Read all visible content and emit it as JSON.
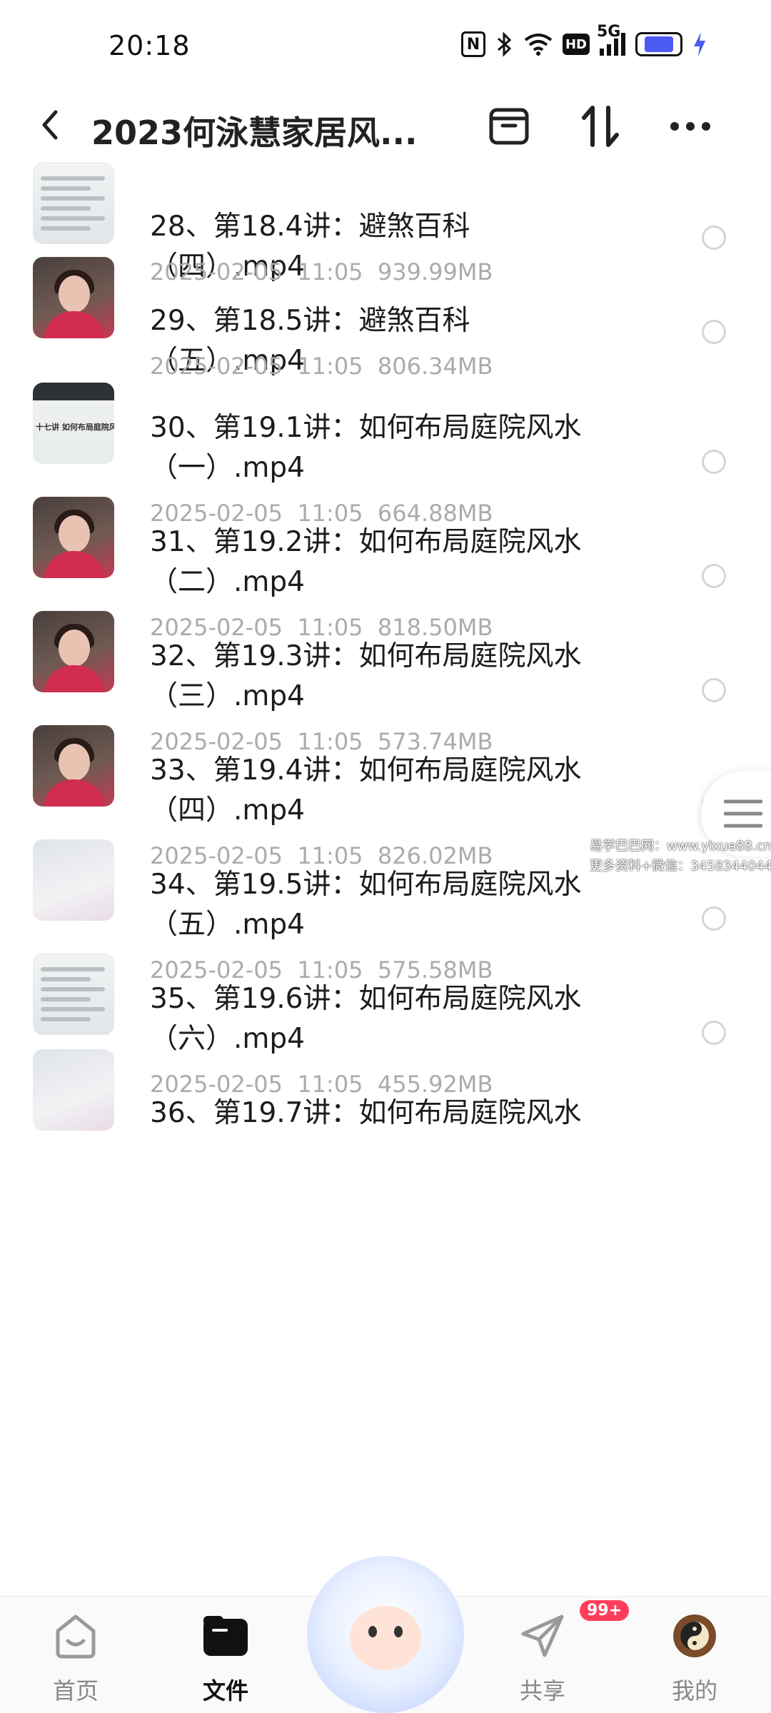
{
  "status_bar": {
    "time": "20:18",
    "icons": [
      "nfc-icon",
      "bluetooth-icon",
      "wifi-icon",
      "hd-icon",
      "signal-5g-icon",
      "battery-icon",
      "charging-bolt-icon"
    ],
    "nfc_label": "N",
    "hd_label": "HD",
    "signal_label": "5G",
    "battery_level": 0.75,
    "battery_color": "#4c5bf1"
  },
  "header": {
    "title": "2023何泳慧家居风...",
    "icons": [
      "back-icon",
      "box-icon",
      "sort-icon",
      "more-icon"
    ]
  },
  "files": [
    {
      "name": "28、第18.4讲：避煞百科（四）.mp4",
      "date": "2025-02-05  11:05",
      "size": "939.99MB",
      "thumb": "doc"
    },
    {
      "name": "29、第18.5讲：避煞百科（五）.mp4",
      "date": "2025-02-05  11:05",
      "size": "806.34MB",
      "thumb": "person"
    },
    {
      "name": "30、第19.1讲：如何布局庭院风水（一）.mp4",
      "date": "2025-02-05  11:05",
      "size": "664.88MB",
      "thumb": "garden",
      "thumb_caption": "十七讲 如何布局庭院风"
    },
    {
      "name": "31、第19.2讲：如何布局庭院风水（二）.mp4",
      "date": "2025-02-05  11:05",
      "size": "818.50MB",
      "thumb": "person"
    },
    {
      "name": "32、第19.3讲：如何布局庭院风水（三）.mp4",
      "date": "2025-02-05  11:05",
      "size": "573.74MB",
      "thumb": "person"
    },
    {
      "name": "33、第19.4讲：如何布局庭院风水（四）.mp4",
      "date": "2025-02-05  11:05",
      "size": "826.02MB",
      "thumb": "person"
    },
    {
      "name": "34、第19.5讲：如何布局庭院风水（五）.mp4",
      "date": "2025-02-05  11:05",
      "size": "575.58MB",
      "thumb": "light"
    },
    {
      "name": "35、第19.6讲：如何布局庭院风水（六）.mp4",
      "date": "2025-02-05  11:05",
      "size": "455.92MB",
      "thumb": "doc"
    },
    {
      "name": "36、第19.7讲：如何布局庭院风水",
      "date": "",
      "size": "",
      "thumb": "light"
    }
  ],
  "watermark": {
    "line1": "易学巴巴网：www.yixue88.cn",
    "line2": "更多资料+微信：3458344044"
  },
  "bottom_nav": {
    "items": [
      {
        "label": "首页",
        "icon": "home-icon",
        "active": false
      },
      {
        "label": "文件",
        "icon": "folder-icon",
        "active": true
      },
      {
        "label": "共享",
        "icon": "share-plane-icon",
        "active": false,
        "badge": "99+"
      },
      {
        "label": "我的",
        "icon": "profile-avatar-icon",
        "active": false
      }
    ]
  },
  "colors": {
    "accent": "#4c5bf1",
    "meta_text": "#a9abae",
    "badge": "#ff3d5a"
  }
}
